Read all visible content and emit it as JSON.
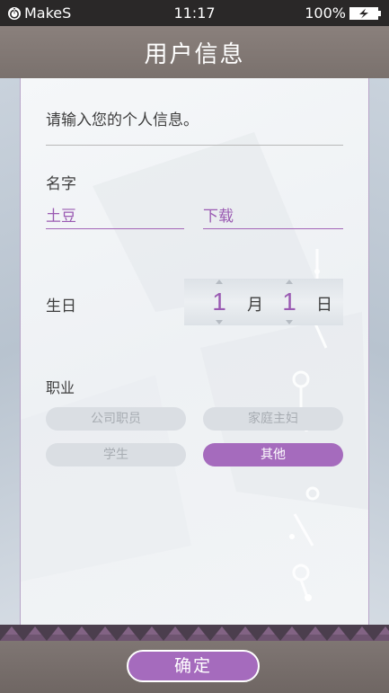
{
  "status_bar": {
    "brand": "MakeS",
    "time": "11:17",
    "battery": "100%"
  },
  "header": {
    "title": "用户信息"
  },
  "form": {
    "intro": "请输入您的个人信息。",
    "name": {
      "label": "名字",
      "first": "土豆",
      "last": "下载"
    },
    "birthday": {
      "label": "生日",
      "month_value": "1",
      "month_unit": "月",
      "day_value": "1",
      "day_unit": "日"
    },
    "occupation": {
      "label": "职业",
      "options": [
        "公司职员",
        "家庭主妇",
        "学生",
        "其他"
      ],
      "selected": "其他"
    }
  },
  "footer": {
    "confirm_label": "确定"
  },
  "colors": {
    "accent": "#a56bbd",
    "status_bar": "#2a2828",
    "title_bar": "#7f7673"
  }
}
